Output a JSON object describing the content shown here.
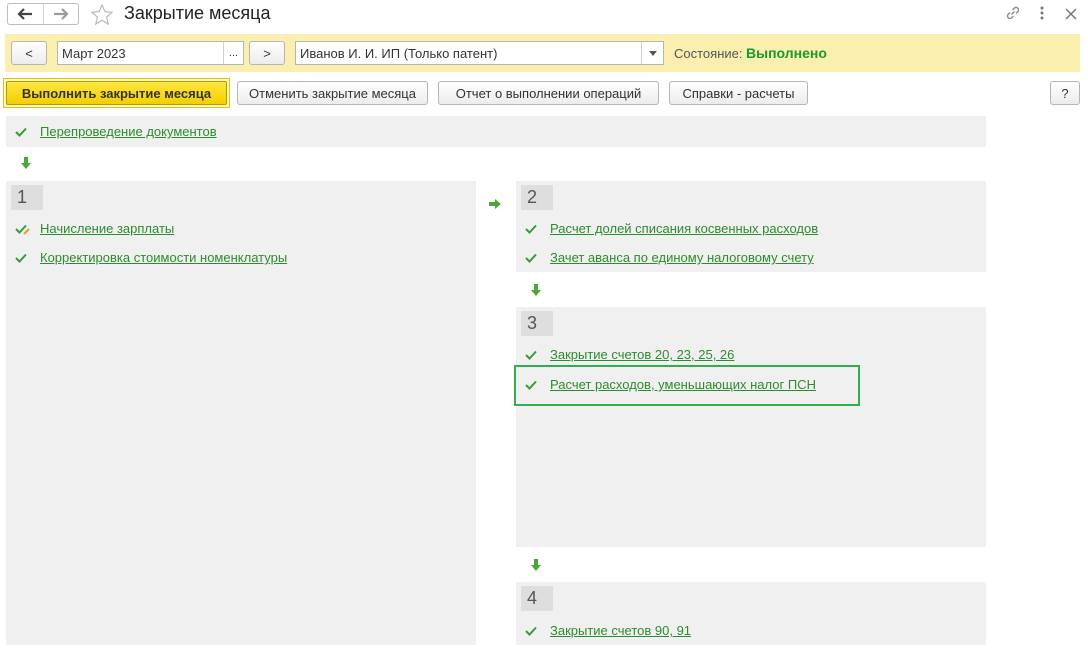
{
  "header": {
    "title": "Закрытие месяца"
  },
  "toolbar": {
    "prev_label": "<",
    "period_value": "Март 2023",
    "period_select_label": "...",
    "next_label": ">",
    "organization_value": "Иванов И. И. ИП (Только патент)",
    "status_label": "Состояние:",
    "status_value": "Выполнено"
  },
  "commands": {
    "run": "Выполнить закрытие месяца",
    "cancel": "Отменить закрытие месяца",
    "report": "Отчет о выполнении операций",
    "references": "Справки - расчеты",
    "help": "?"
  },
  "reposting": {
    "label": "Перепроведение документов"
  },
  "stages": [
    {
      "number": "1",
      "operations": [
        "Начисление зарплаты",
        "Корректировка стоимости номенклатуры"
      ]
    },
    {
      "number": "2",
      "operations": [
        "Расчет долей списания косвенных расходов",
        "Зачет аванса по единому налоговому счету"
      ]
    },
    {
      "number": "3",
      "operations": [
        "Закрытие счетов 20, 23, 25, 26",
        "Расчет расходов, уменьшающих налог ПСН"
      ]
    },
    {
      "number": "4",
      "operations": [
        "Закрытие счетов 90, 91"
      ]
    }
  ],
  "colors": {
    "accent_yellow": "#fbefb0",
    "primary_button": "#f3cf00",
    "success_green": "#1a9a2a",
    "link_green": "#2d8c2d",
    "highlight_border": "#2eb04f",
    "panel_bg": "#f0f0f0"
  },
  "icons": {
    "back": "arrow-left-icon",
    "forward": "arrow-right-icon",
    "favorite": "star-icon",
    "link": "link-icon",
    "more": "more-vertical-icon",
    "close": "close-icon",
    "done": "checkmark-icon"
  }
}
